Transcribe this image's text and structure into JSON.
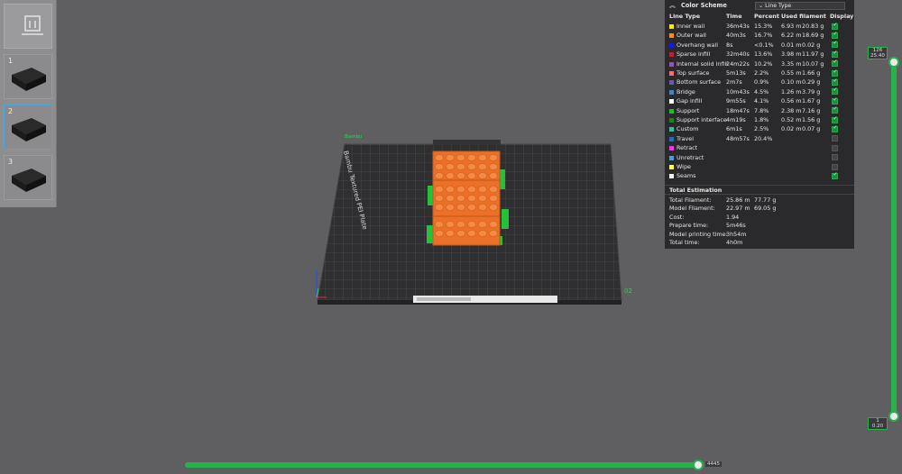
{
  "plates": [
    {
      "number": "1"
    },
    {
      "number": "2"
    },
    {
      "number": "3"
    }
  ],
  "viewport": {
    "plate_name": "Bambu Textured PEI Plate",
    "plate_id": "02",
    "origin_label": "Bambu"
  },
  "legend": {
    "title": "Color Scheme",
    "scheme": "Line Type",
    "columns": [
      "Line Type",
      "Time",
      "Percent",
      "Used filament",
      "Display"
    ],
    "rows": [
      {
        "name": "Inner wall",
        "time": "36m43s",
        "percent": "15.3%",
        "length": "6.93 m",
        "weight": "20.83 g",
        "color": "#ffe600",
        "display": true
      },
      {
        "name": "Outer wall",
        "time": "40m3s",
        "percent": "16.7%",
        "length": "6.22 m",
        "weight": "18.69 g",
        "color": "#ff8c1a",
        "display": true
      },
      {
        "name": "Overhang wall",
        "time": "8s",
        "percent": "<0.1%",
        "length": "0.01 m",
        "weight": "0.02 g",
        "color": "#1a1ad9",
        "display": true
      },
      {
        "name": "Sparse infill",
        "time": "32m40s",
        "percent": "13.6%",
        "length": "3.98 m",
        "weight": "11.97 g",
        "color": "#b3262e",
        "display": true
      },
      {
        "name": "Internal solid infill",
        "time": "24m22s",
        "percent": "10.2%",
        "length": "3.35 m",
        "weight": "10.07 g",
        "color": "#9c4fb8",
        "display": true
      },
      {
        "name": "Top surface",
        "time": "5m13s",
        "percent": "2.2%",
        "length": "0.55 m",
        "weight": "1.66 g",
        "color": "#ff6a6a",
        "display": true
      },
      {
        "name": "Bottom surface",
        "time": "2m7s",
        "percent": "0.9%",
        "length": "0.10 m",
        "weight": "0.29 g",
        "color": "#6a5aa8",
        "display": true
      },
      {
        "name": "Bridge",
        "time": "10m43s",
        "percent": "4.5%",
        "length": "1.26 m",
        "weight": "3.79 g",
        "color": "#4d80b8",
        "display": true
      },
      {
        "name": "Gap infill",
        "time": "9m55s",
        "percent": "4.1%",
        "length": "0.56 m",
        "weight": "1.67 g",
        "color": "#ffffff",
        "display": true
      },
      {
        "name": "Support",
        "time": "18m47s",
        "percent": "7.8%",
        "length": "2.38 m",
        "weight": "7.16 g",
        "color": "#20c020",
        "display": true
      },
      {
        "name": "Support interface",
        "time": "4m19s",
        "percent": "1.8%",
        "length": "0.52 m",
        "weight": "1.56 g",
        "color": "#128a12",
        "display": true
      },
      {
        "name": "Custom",
        "time": "6m1s",
        "percent": "2.5%",
        "length": "0.02 m",
        "weight": "0.07 g",
        "color": "#2ec49a",
        "display": true
      },
      {
        "name": "Travel",
        "time": "48m57s",
        "percent": "20.4%",
        "length": "",
        "weight": "",
        "color": "#2a6fa8",
        "display": false
      },
      {
        "name": "Retract",
        "time": "",
        "percent": "",
        "length": "",
        "weight": "",
        "color": "#e040e0",
        "display": false
      },
      {
        "name": "Unretract",
        "time": "",
        "percent": "",
        "length": "",
        "weight": "",
        "color": "#40a0e0",
        "display": false
      },
      {
        "name": "Wipe",
        "time": "",
        "percent": "",
        "length": "",
        "weight": "",
        "color": "#ffff40",
        "display": false
      },
      {
        "name": "Seams",
        "time": "",
        "percent": "",
        "length": "",
        "weight": "",
        "color": "#f0f0f0",
        "display": true
      }
    ],
    "estimation_title": "Total Estimation",
    "estimation": [
      {
        "label": "Total Filament:",
        "v1": "25.86 m",
        "v2": "77.77 g"
      },
      {
        "label": "Model Filament:",
        "v1": "22.97 m",
        "v2": "69.05 g"
      },
      {
        "label": "Cost:",
        "v1": "1.94",
        "v2": ""
      },
      {
        "label": "Prepare time:",
        "v1": "5m46s",
        "v2": ""
      },
      {
        "label": "Model printing time:",
        "v1": "3h54m",
        "v2": ""
      },
      {
        "label": "Total time:",
        "v1": "4h0m",
        "v2": ""
      }
    ]
  },
  "layer_slider": {
    "top_layer": "126",
    "top_height": "25.40",
    "bottom_layer": "1",
    "bottom_height": "0.20"
  },
  "move_slider": {
    "value": "4445"
  },
  "colors": {
    "accent": "#26b34a",
    "model": "#f07a2c",
    "support": "#22c33a"
  }
}
